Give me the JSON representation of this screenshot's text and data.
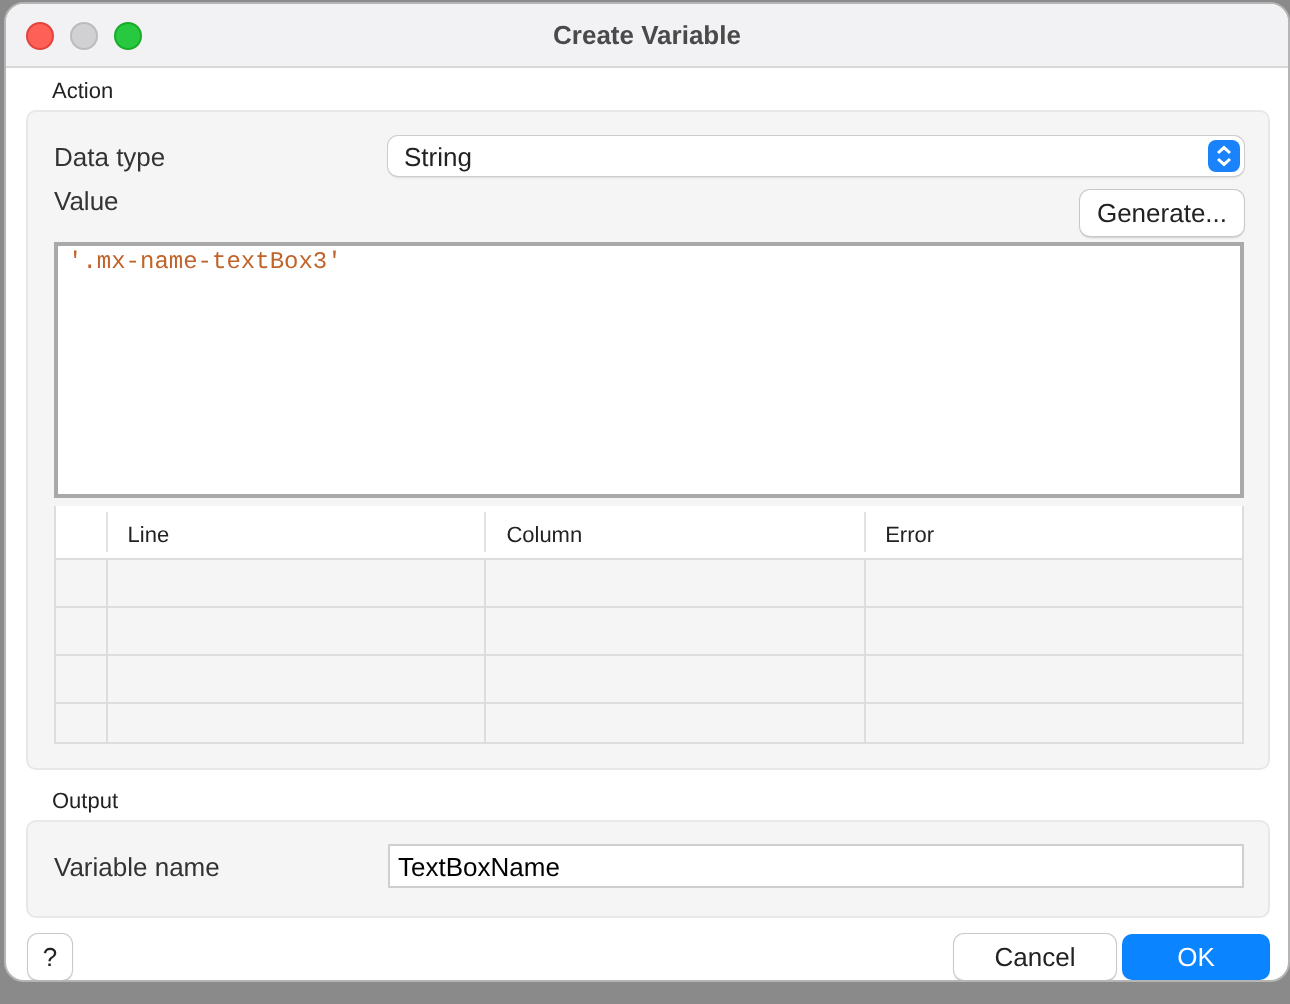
{
  "window": {
    "title": "Create Variable"
  },
  "action": {
    "label": "Action",
    "data_type": {
      "label": "Data type",
      "value": "String"
    },
    "value": {
      "label": "Value",
      "generate_button": "Generate...",
      "code": "'.mx-name-textBox3'"
    },
    "errors_table": {
      "columns": [
        "Line",
        "Column",
        "Error"
      ]
    }
  },
  "output": {
    "label": "Output",
    "variable_name": {
      "label": "Variable name",
      "value": "TextBoxName"
    }
  },
  "buttons": {
    "help": "?",
    "cancel": "Cancel",
    "ok": "OK"
  }
}
